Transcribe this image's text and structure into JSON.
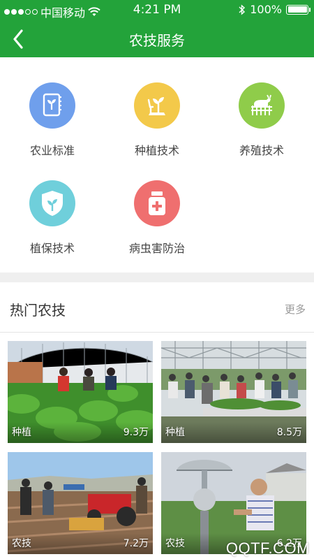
{
  "status_bar": {
    "carrier": "中国移动",
    "time": "4:21 PM",
    "battery": "100%"
  },
  "nav": {
    "title": "农技服务",
    "back_icon": "chevron-left-icon"
  },
  "categories": [
    {
      "label": "农业标准",
      "icon": "book-sprout-icon",
      "color": "#6f9fec"
    },
    {
      "label": "种植技术",
      "icon": "planting-icon",
      "color": "#f3c94a"
    },
    {
      "label": "养殖技术",
      "icon": "goat-fence-icon",
      "color": "#8fcc4a"
    },
    {
      "label": "植保技术",
      "icon": "shield-sprout-icon",
      "color": "#6fcfdb"
    },
    {
      "label": "病虫害防治",
      "icon": "medicine-bottle-icon",
      "color": "#ef6f6f"
    }
  ],
  "hot": {
    "title": "热门农技",
    "more": "更多",
    "cards": [
      {
        "tag": "种植",
        "views": "9.3万",
        "image": "greenhouse-farmers-photo"
      },
      {
        "tag": "种植",
        "views": "8.5万",
        "image": "greenhouse-visitors-photo"
      },
      {
        "tag": "农技",
        "views": "7.2万",
        "image": "field-machinery-photo"
      },
      {
        "tag": "农技",
        "views": "6.2万",
        "image": "weather-instrument-photo"
      }
    ]
  },
  "watermark": "QQTF.COM",
  "colors": {
    "brand_green": "#23a33a"
  }
}
